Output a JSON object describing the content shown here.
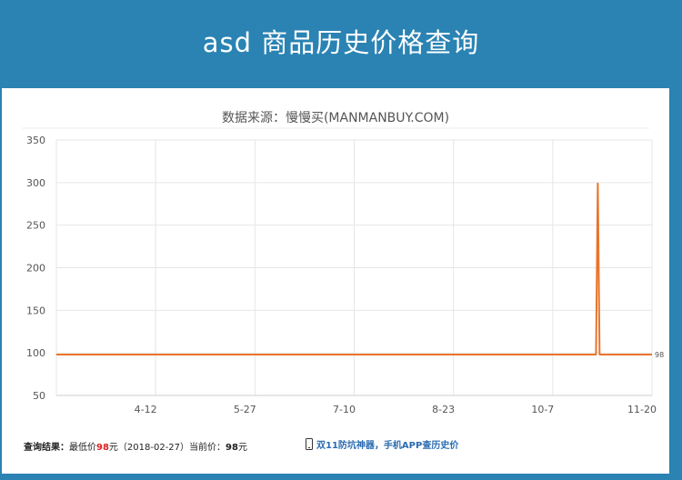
{
  "header": {
    "title": "asd 商品历史价格查询"
  },
  "chart_data": {
    "type": "line",
    "title": "数据来源：慢慢买(MANMANBUY.COM)",
    "xlabel": "",
    "ylabel": "",
    "ylim": [
      50,
      350
    ],
    "y_ticks": [
      "350",
      "300",
      "250",
      "200",
      "150",
      "100",
      "50"
    ],
    "x_ticks": [
      "4-12",
      "5-27",
      "7-10",
      "8-23",
      "10-7",
      "11-20"
    ],
    "grid": true,
    "color": "#e8742c",
    "series": [
      {
        "points": [
          [
            0,
            98
          ],
          [
            0.906,
            98
          ],
          [
            0.909,
            299
          ],
          [
            0.912,
            98
          ],
          [
            1,
            98
          ]
        ]
      }
    ],
    "end_label": "98"
  },
  "footer": {
    "label": "查询结果：",
    "lowest_label": "最低价",
    "lowest_price": "98",
    "yuan": "元",
    "lowest_date": "（2018-02-27）",
    "current_label": "当前价：",
    "current_price": "98",
    "yuan2": "元",
    "app_text": "双11防坑神器，手机APP查历史价"
  }
}
